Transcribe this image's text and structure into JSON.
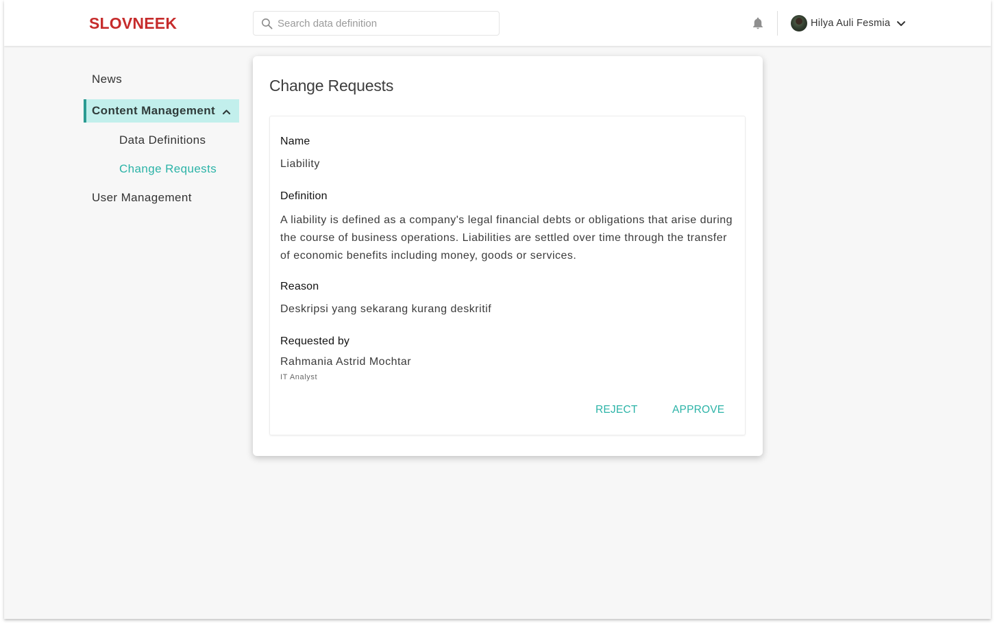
{
  "header": {
    "logo": "SLOVNEEK",
    "search_placeholder": "Search data definition",
    "user_name": "Hilya Auli Fesmia"
  },
  "sidebar": {
    "items": [
      {
        "label": "News"
      },
      {
        "label": "Content Management",
        "expanded": true,
        "children": [
          {
            "label": "Data Definitions"
          },
          {
            "label": "Change Requests",
            "active": true
          }
        ]
      },
      {
        "label": "User Management"
      }
    ]
  },
  "card": {
    "title": "Change Requests",
    "fields": {
      "name_label": "Name",
      "name_value": "Liability",
      "definition_label": "Definition",
      "definition_value": "A liability is defined as a company's legal financial debts or obligations that arise during the course of business operations. Liabilities are settled over time through the transfer of economic benefits including money, goods or services.",
      "reason_label": "Reason",
      "reason_value": "Deskripsi yang sekarang kurang deskritif",
      "requested_by_label": "Requested by",
      "requested_by_name": "Rahmania Astrid Mochtar",
      "requested_by_role": "IT Analyst"
    },
    "actions": {
      "reject": "REJECT",
      "approve": "APPROVE"
    }
  },
  "colors": {
    "brand": "#c62c2c",
    "accent": "#2bb3a7",
    "active_bg": "#c2efec",
    "active_border": "#2b9b92"
  },
  "icons": [
    "search-icon",
    "bell-icon",
    "avatar",
    "chevron-down-icon",
    "chevron-up-icon"
  ]
}
